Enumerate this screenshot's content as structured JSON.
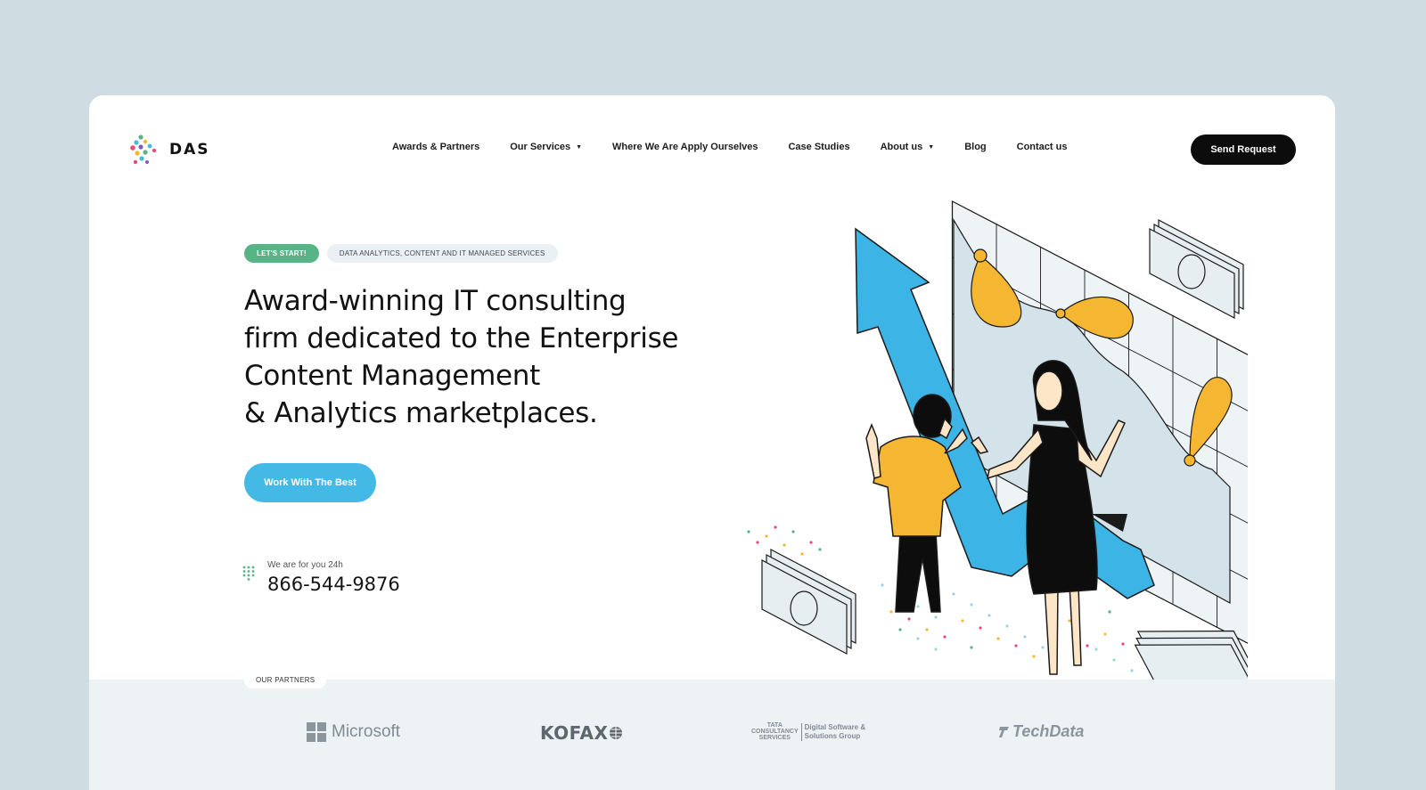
{
  "brand": {
    "name": "DAS"
  },
  "nav": {
    "items": [
      {
        "label": "Awards & Partners",
        "dropdown": false
      },
      {
        "label": "Our Services",
        "dropdown": true
      },
      {
        "label": "Where We Are Apply Ourselves",
        "dropdown": false
      },
      {
        "label": "Case Studies",
        "dropdown": false
      },
      {
        "label": "About us",
        "dropdown": true
      },
      {
        "label": "Blog",
        "dropdown": false
      },
      {
        "label": "Contact us",
        "dropdown": false
      }
    ],
    "cta_label": "Send Request"
  },
  "hero": {
    "tag_primary": "LET'S START!",
    "tag_secondary": "DATA ANALYTICS, CONTENT AND IT MANAGED SERVICES",
    "headline_lines": [
      "Award-winning IT consulting",
      "firm dedicated to the Enterprise",
      "Content Management",
      "& Analytics marketplaces."
    ],
    "cta_label": "Work With The Best",
    "contact_label": "We are for you 24h",
    "phone": "866-544-9876"
  },
  "partners": {
    "label": "OUR PARTNERS",
    "microsoft": "Microsoft",
    "kofax": "KOFAX",
    "tcs_left": [
      "TATA",
      "CONSULTANCY",
      "SERVICES"
    ],
    "tcs_right": [
      "Digital Software &",
      "Solutions Group"
    ],
    "techdata": "TechData"
  },
  "colors": {
    "background": "#cfdce1",
    "card": "#ffffff",
    "accent_blue": "#45b9e6",
    "accent_green": "#57b486",
    "accent_yellow": "#f5b731",
    "dark": "#0c0c0c",
    "partners_bg": "#edf2f5"
  },
  "icons": [
    "logo-mark-icon",
    "dropdown-caret-icon",
    "phone-keypad-icon",
    "microsoft-windows-icon",
    "kofax-globe-icon",
    "techdata-mark-icon"
  ]
}
